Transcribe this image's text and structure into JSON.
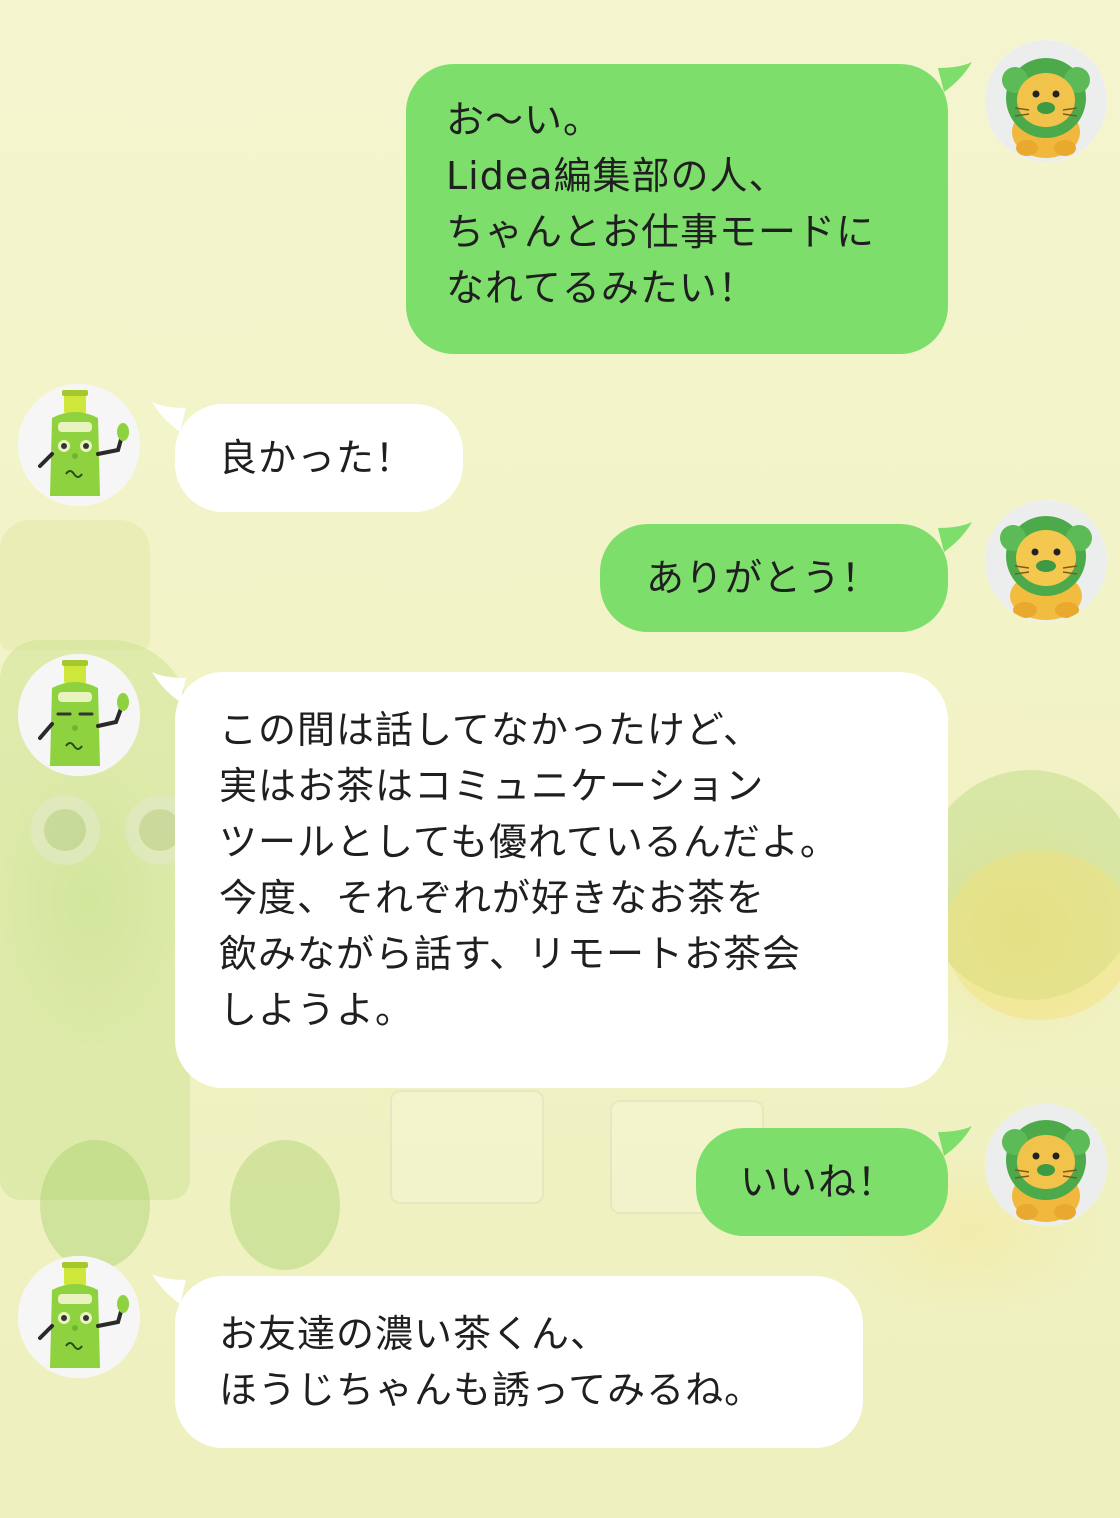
{
  "chat": {
    "messages": [
      {
        "sender": "lion",
        "side": "right",
        "text": "お〜い。\nLidea編集部の人、\nちゃんとお仕事モードに\nなれてるみたい！"
      },
      {
        "sender": "bottle",
        "side": "left",
        "text": "良かった！"
      },
      {
        "sender": "lion",
        "side": "right",
        "text": "ありがとう！"
      },
      {
        "sender": "bottle",
        "side": "left",
        "text": "この間は話してなかったけど、\n実はお茶はコミュニケーション\nツールとしても優れているんだよ。\n今度、それぞれが好きなお茶を\n飲みながら話す、リモートお茶会\nしようよ。"
      },
      {
        "sender": "lion",
        "side": "right",
        "text": "いいね！"
      },
      {
        "sender": "bottle",
        "side": "left",
        "text": "お友達の濃い茶くん、\nほうじちゃんも誘ってみるね。"
      }
    ]
  },
  "avatars": {
    "lion": {
      "icon": "lion-plush-avatar"
    },
    "bottle": {
      "icon": "tea-bottle-character-avatar"
    }
  },
  "colors": {
    "my_bubble": "#7ede6b",
    "their_bubble": "#ffffff",
    "background": "#f3f4c8"
  }
}
